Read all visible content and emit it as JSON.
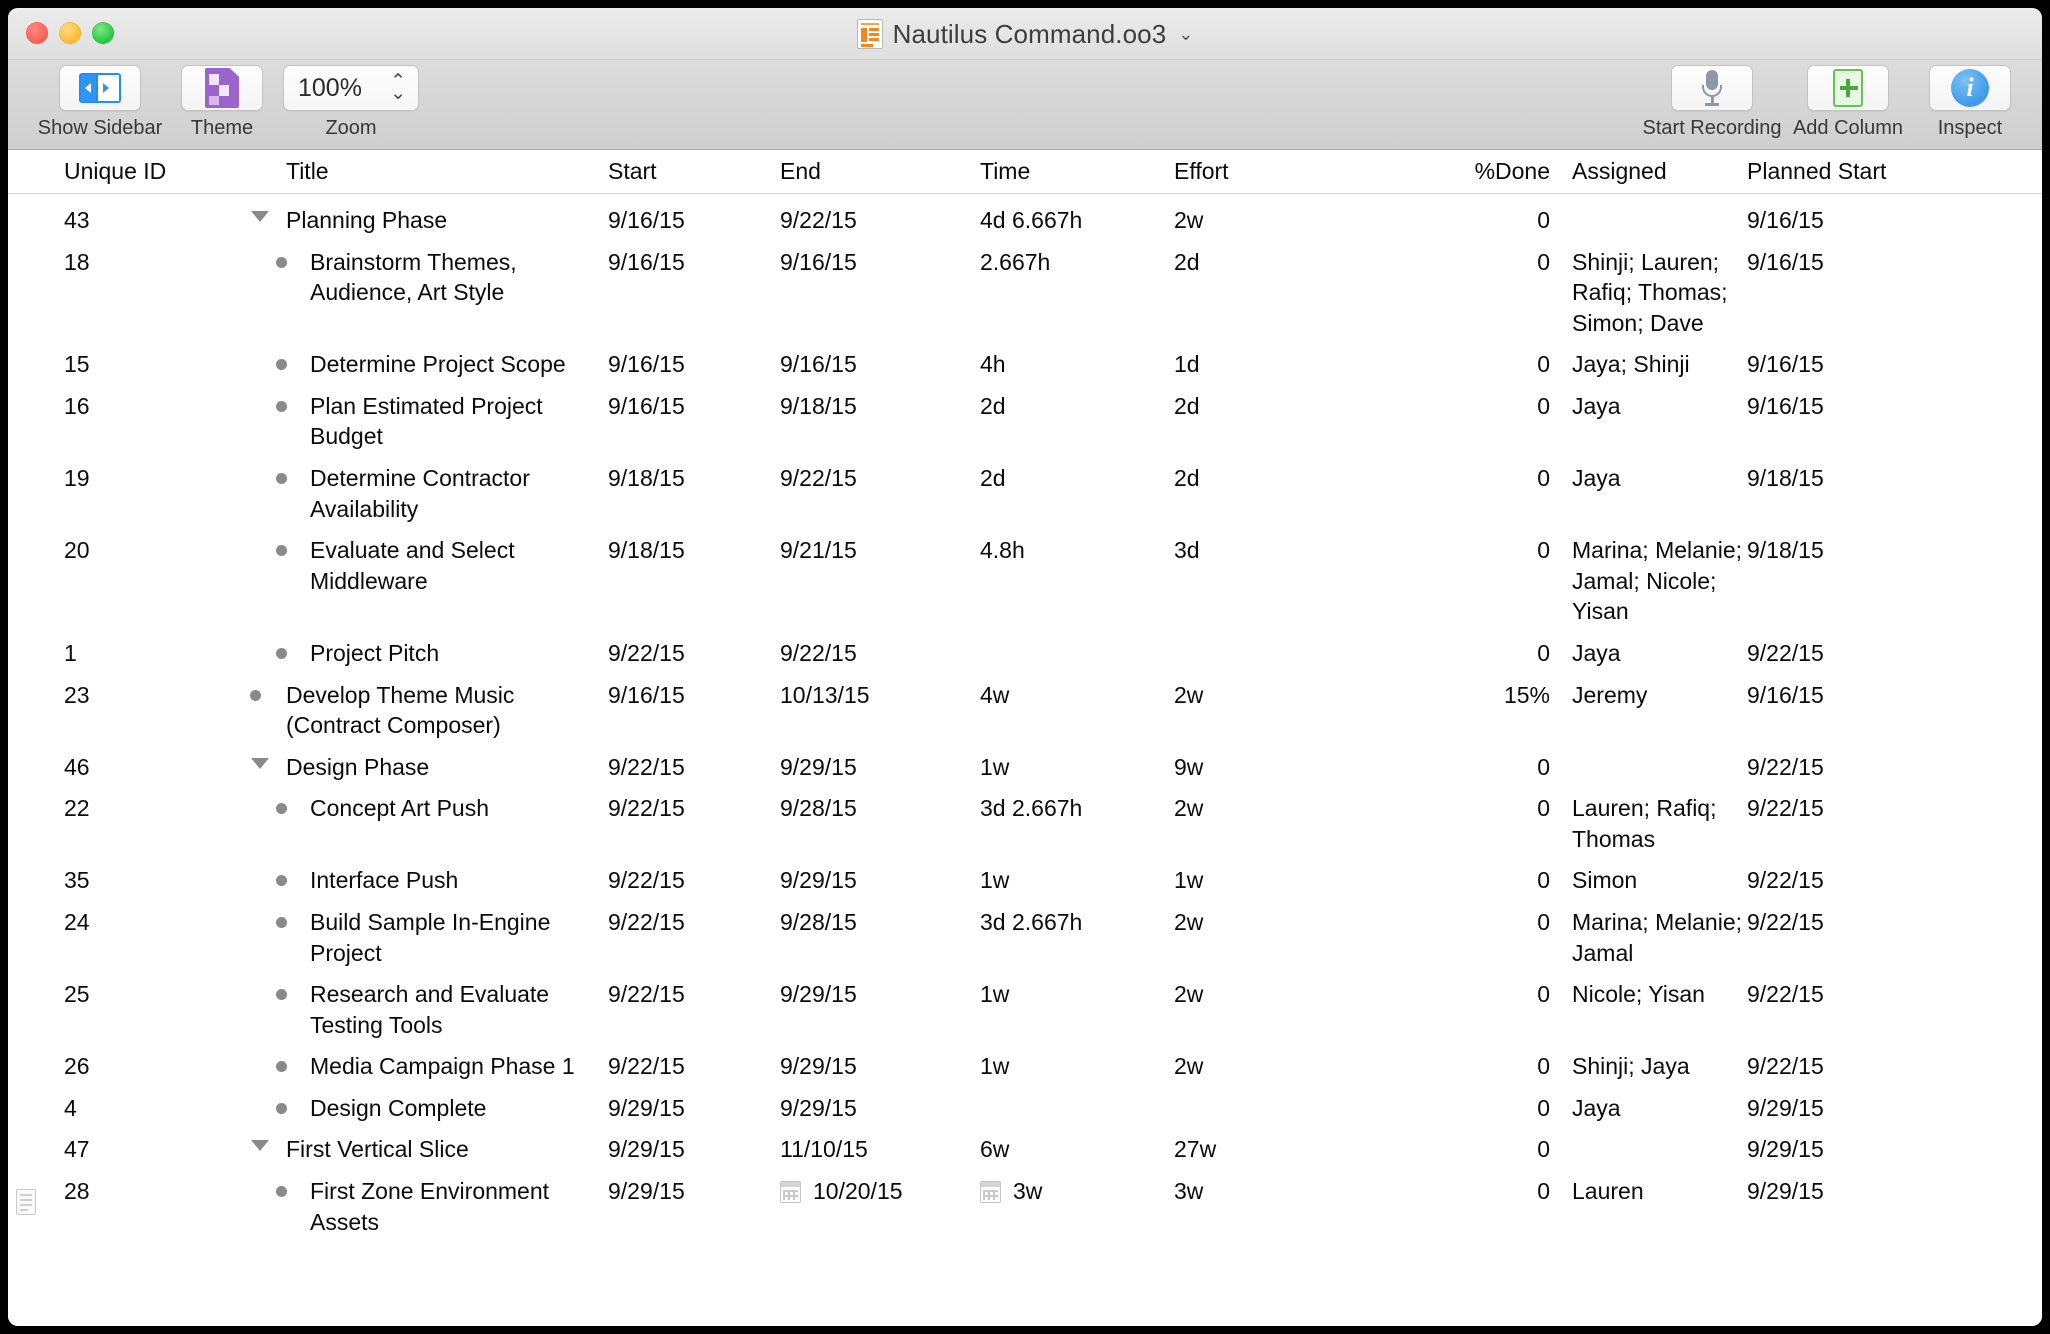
{
  "window": {
    "title": "Nautilus Command.oo3",
    "title_chevron": "⌄",
    "traffic_lights": [
      "close",
      "minimize",
      "zoom"
    ]
  },
  "toolbar": {
    "left_items": [
      {
        "name": "show-sidebar",
        "label": "Show Sidebar",
        "icon": "sidebar-icon"
      },
      {
        "name": "theme",
        "label": "Theme",
        "icon": "theme-icon"
      }
    ],
    "zoom": {
      "label": "Zoom",
      "value": "100%",
      "stepper_up": "⌃",
      "stepper_down": "⌄"
    },
    "right_items": [
      {
        "name": "start-recording",
        "label": "Start Recording",
        "icon": "microphone-icon"
      },
      {
        "name": "add-column",
        "label": "Add Column",
        "icon": "add-column-icon"
      },
      {
        "name": "inspect",
        "label": "Inspect",
        "icon": "info-icon"
      }
    ]
  },
  "table": {
    "columns": [
      "Unique ID",
      "Title",
      "Start",
      "End",
      "Time",
      "Effort",
      "%Done",
      "Assigned",
      "Planned Start"
    ],
    "rows": [
      {
        "note": false,
        "id": "43",
        "title": "Planning Phase",
        "marker": "twisty",
        "level": 1,
        "start": "9/16/15",
        "end": "9/22/15",
        "time": "4d 6.667h",
        "effort": "2w",
        "done": "0",
        "assigned": "",
        "planned_start": "9/16/15",
        "cal_end": false,
        "cal_time": false
      },
      {
        "note": false,
        "id": "18",
        "title": "Brainstorm Themes, Audience, Art Style",
        "marker": "bullet",
        "level": 2,
        "start": "9/16/15",
        "end": "9/16/15",
        "time": "2.667h",
        "effort": "2d",
        "done": "0",
        "assigned": "Shinji; Lauren; Rafiq; Thomas; Simon; Dave",
        "planned_start": "9/16/15",
        "cal_end": false,
        "cal_time": false
      },
      {
        "note": false,
        "id": "15",
        "title": "Determine Project Scope",
        "marker": "bullet",
        "level": 2,
        "start": "9/16/15",
        "end": "9/16/15",
        "time": "4h",
        "effort": "1d",
        "done": "0",
        "assigned": "Jaya; Shinji",
        "planned_start": "9/16/15",
        "cal_end": false,
        "cal_time": false
      },
      {
        "note": false,
        "id": "16",
        "title": "Plan Estimated Project Budget",
        "marker": "bullet",
        "level": 2,
        "start": "9/16/15",
        "end": "9/18/15",
        "time": "2d",
        "effort": "2d",
        "done": "0",
        "assigned": "Jaya",
        "planned_start": "9/16/15",
        "cal_end": false,
        "cal_time": false
      },
      {
        "note": false,
        "id": "19",
        "title": "Determine Contractor Availability",
        "marker": "bullet",
        "level": 2,
        "start": "9/18/15",
        "end": "9/22/15",
        "time": "2d",
        "effort": "2d",
        "done": "0",
        "assigned": "Jaya",
        "planned_start": "9/18/15",
        "cal_end": false,
        "cal_time": false
      },
      {
        "note": false,
        "id": "20",
        "title": "Evaluate and Select Middleware",
        "marker": "bullet",
        "level": 2,
        "start": "9/18/15",
        "end": "9/21/15",
        "time": "4.8h",
        "effort": "3d",
        "done": "0",
        "assigned": "Marina; Melanie; Jamal; Nicole; Yisan",
        "planned_start": "9/18/15",
        "cal_end": false,
        "cal_time": false
      },
      {
        "note": false,
        "id": "1",
        "title": "Project Pitch",
        "marker": "bullet",
        "level": 2,
        "start": "9/22/15",
        "end": "9/22/15",
        "time": "",
        "effort": "",
        "done": "0",
        "assigned": "Jaya",
        "planned_start": "9/22/15",
        "cal_end": false,
        "cal_time": false
      },
      {
        "note": false,
        "id": "23",
        "title": "Develop Theme Music (Contract Composer)",
        "marker": "bullet",
        "level": 1,
        "start": "9/16/15",
        "end": "10/13/15",
        "time": "4w",
        "effort": "2w",
        "done": "15%",
        "assigned": "Jeremy",
        "planned_start": "9/16/15",
        "cal_end": false,
        "cal_time": false
      },
      {
        "note": false,
        "id": "46",
        "title": "Design Phase",
        "marker": "twisty",
        "level": 1,
        "start": "9/22/15",
        "end": "9/29/15",
        "time": "1w",
        "effort": "9w",
        "done": "0",
        "assigned": "",
        "planned_start": "9/22/15",
        "cal_end": false,
        "cal_time": false
      },
      {
        "note": false,
        "id": "22",
        "title": "Concept Art Push",
        "marker": "bullet",
        "level": 2,
        "start": "9/22/15",
        "end": "9/28/15",
        "time": "3d 2.667h",
        "effort": "2w",
        "done": "0",
        "assigned": "Lauren; Rafiq; Thomas",
        "planned_start": "9/22/15",
        "cal_end": false,
        "cal_time": false
      },
      {
        "note": false,
        "id": "35",
        "title": "Interface Push",
        "marker": "bullet",
        "level": 2,
        "start": "9/22/15",
        "end": "9/29/15",
        "time": "1w",
        "effort": "1w",
        "done": "0",
        "assigned": "Simon",
        "planned_start": "9/22/15",
        "cal_end": false,
        "cal_time": false
      },
      {
        "note": false,
        "id": "24",
        "title": "Build Sample In-Engine Project",
        "marker": "bullet",
        "level": 2,
        "start": "9/22/15",
        "end": "9/28/15",
        "time": "3d 2.667h",
        "effort": "2w",
        "done": "0",
        "assigned": "Marina; Melanie; Jamal",
        "planned_start": "9/22/15",
        "cal_end": false,
        "cal_time": false
      },
      {
        "note": false,
        "id": "25",
        "title": "Research and Evaluate Testing Tools",
        "marker": "bullet",
        "level": 2,
        "start": "9/22/15",
        "end": "9/29/15",
        "time": "1w",
        "effort": "2w",
        "done": "0",
        "assigned": "Nicole; Yisan",
        "planned_start": "9/22/15",
        "cal_end": false,
        "cal_time": false
      },
      {
        "note": false,
        "id": "26",
        "title": "Media Campaign Phase 1",
        "marker": "bullet",
        "level": 2,
        "start": "9/22/15",
        "end": "9/29/15",
        "time": "1w",
        "effort": "2w",
        "done": "0",
        "assigned": "Shinji; Jaya",
        "planned_start": "9/22/15",
        "cal_end": false,
        "cal_time": false
      },
      {
        "note": false,
        "id": "4",
        "title": "Design Complete",
        "marker": "bullet",
        "level": 2,
        "start": "9/29/15",
        "end": "9/29/15",
        "time": "",
        "effort": "",
        "done": "0",
        "assigned": "Jaya",
        "planned_start": "9/29/15",
        "cal_end": false,
        "cal_time": false
      },
      {
        "note": false,
        "id": "47",
        "title": "First Vertical Slice",
        "marker": "twisty",
        "level": 1,
        "start": "9/29/15",
        "end": "11/10/15",
        "time": "6w",
        "effort": "27w",
        "done": "0",
        "assigned": "",
        "planned_start": "9/29/15",
        "cal_end": false,
        "cal_time": false
      },
      {
        "note": true,
        "id": "28",
        "title": "First Zone Environment Assets",
        "marker": "bullet",
        "level": 2,
        "start": "9/29/15",
        "end": "10/20/15",
        "time": "3w",
        "effort": "3w",
        "done": "0",
        "assigned": "Lauren",
        "planned_start": "9/29/15",
        "cal_end": true,
        "cal_time": true
      }
    ]
  }
}
